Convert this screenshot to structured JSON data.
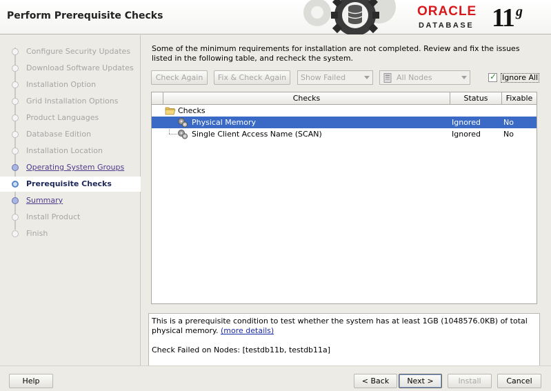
{
  "header": {
    "title": "Perform Prerequisite Checks",
    "logo": {
      "oracle": "ORACLE",
      "database": "DATABASE",
      "version": "11",
      "version_sup": "g"
    },
    "brand_color": "#d8181b"
  },
  "sidebar": {
    "steps": [
      {
        "label": "Configure Security Updates",
        "state": "done"
      },
      {
        "label": "Download Software Updates",
        "state": "done"
      },
      {
        "label": "Installation Option",
        "state": "done"
      },
      {
        "label": "Grid Installation Options",
        "state": "done"
      },
      {
        "label": "Product Languages",
        "state": "done"
      },
      {
        "label": "Database Edition",
        "state": "done"
      },
      {
        "label": "Installation Location",
        "state": "done"
      },
      {
        "label": "Operating System Groups",
        "state": "visited"
      },
      {
        "label": "Prerequisite Checks",
        "state": "current"
      },
      {
        "label": "Summary",
        "state": "visited"
      },
      {
        "label": "Install Product",
        "state": "pending"
      },
      {
        "label": "Finish",
        "state": "pending"
      }
    ]
  },
  "main": {
    "intro_text": "Some of the minimum requirements for installation are not completed. Review and fix the issues listed in the following table, and recheck the system.",
    "toolbar": {
      "check_again": "Check Again",
      "fix_check_again": "Fix & Check Again",
      "show_filter": "Show Failed",
      "nodes_filter": "All Nodes",
      "ignore_all_label": "Ignore All",
      "ignore_all_checked": true
    },
    "table": {
      "columns": [
        "Checks",
        "Status",
        "Fixable"
      ],
      "root": "Checks",
      "rows": [
        {
          "check": "Physical Memory",
          "status": "Ignored",
          "fixable": "No",
          "selected": true
        },
        {
          "check": "Single Client Access Name (SCAN)",
          "status": "Ignored",
          "fixable": "No",
          "selected": false
        }
      ]
    },
    "details": {
      "text": "This is a prerequisite condition to test whether the system has at least 1GB (1048576.0KB) of total physical memory.",
      "more_link": "(more details)",
      "failed_nodes": "Check Failed on Nodes: [testdb11b, testdb11a]"
    }
  },
  "footer": {
    "help": "Help",
    "back": "< Back",
    "next": "Next >",
    "install": "Install",
    "cancel": "Cancel"
  }
}
